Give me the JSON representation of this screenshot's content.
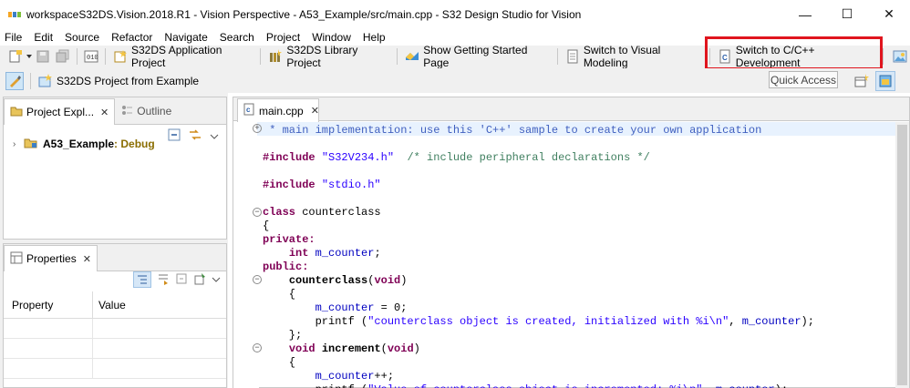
{
  "window": {
    "title": "workspaceS32DS.Vision.2018.R1 - Vision Perspective - A53_Example/src/main.cpp - S32 Design Studio for Vision",
    "controls": [
      "—",
      "☐",
      "✕"
    ]
  },
  "menubar": [
    "File",
    "Edit",
    "Source",
    "Refactor",
    "Navigate",
    "Search",
    "Project",
    "Window",
    "Help"
  ],
  "toolbar": {
    "buttons": [
      {
        "label": "S32DS Application Project",
        "icon": "new-project-icon"
      },
      {
        "label": "S32DS Library Project",
        "icon": "library-project-icon"
      },
      {
        "label": "Show Getting Started Page",
        "icon": "getting-started-icon"
      },
      {
        "label": "Switch to Visual Modeling",
        "icon": "visual-modeling-icon"
      },
      {
        "label": "Switch to C/C++ Development",
        "icon": "cpp-development-icon"
      }
    ],
    "second_row_button": "S32DS Project from Example",
    "quick_access": "Quick Access"
  },
  "colors": {
    "highlight": "#e0151e",
    "keyword": "#7f0055",
    "string": "#2a00ff",
    "comment": "#3f7f5f"
  },
  "project_explorer": {
    "tabs": [
      {
        "label": "Project Expl..."
      },
      {
        "label": "Outline"
      }
    ],
    "tree": [
      {
        "name": "A53_Example",
        "suffix": ": Debug"
      }
    ]
  },
  "properties": {
    "tab": "Properties",
    "columns": [
      "Property",
      "Value"
    ]
  },
  "editor": {
    "tab": "main.cpp",
    "lines": [
      " * main implementation: use this 'C++' sample to create your own application",
      "",
      "#include \"S32V234.h\"  /* include peripheral declarations */",
      "",
      "#include \"stdio.h\"",
      "",
      "class counterclass",
      "{",
      "private:",
      "    int m_counter;",
      "public:",
      "    counterclass(void)",
      "    {",
      "        m_counter = 0;",
      "        printf (\"counterclass object is created, initialized with %i\\n\", m_counter);",
      "    };",
      "    void increment(void)",
      "    {",
      "        m_counter++;",
      "        printf (\"Value of counterclass object is incremented: %i\\n\", m_counter);"
    ]
  }
}
